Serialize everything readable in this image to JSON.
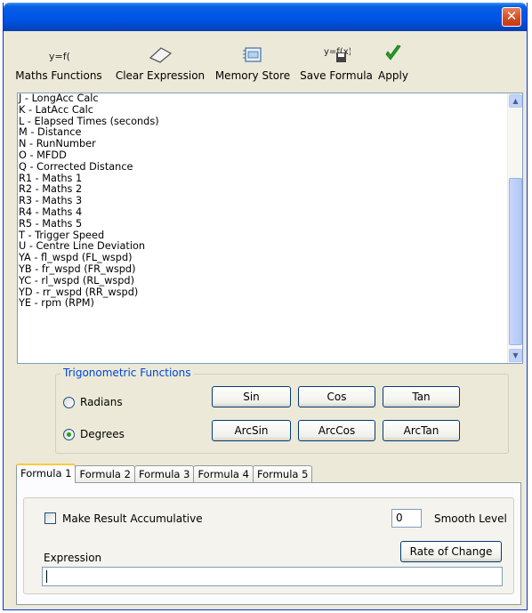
{
  "toolbar": {
    "buttons": [
      {
        "label": "Maths Functions",
        "icon": "function-icon"
      },
      {
        "label": "Clear Expression",
        "icon": "eraser-icon"
      },
      {
        "label": "Memory Store",
        "icon": "memory-card-icon"
      },
      {
        "label": "Save Formula",
        "icon": "save-formula-icon"
      },
      {
        "label": "Apply",
        "icon": "checkmark-icon"
      }
    ]
  },
  "channels": [
    "J - LongAcc Calc",
    "K - LatAcc Calc",
    "L - Elapsed Times (seconds)",
    "M - Distance",
    "N - RunNumber",
    "O - MFDD",
    "Q - Corrected Distance",
    "R1 - Maths 1",
    "R2 - Maths 2",
    "R3 - Maths 3",
    "R4 - Maths 4",
    "R5 - Maths 5",
    "T - Trigger Speed",
    "U - Centre Line Deviation",
    "YA - fl_wspd (FL_wspd)",
    "YB - fr_wspd (FR_wspd)",
    "YC - rl_wspd (RL_wspd)",
    "YD - rr_wspd (RR_wspd)",
    "YE - rpm (RPM)"
  ],
  "trig": {
    "title": "Trigonometric Functions",
    "radians_label": "Radians",
    "degrees_label": "Degrees",
    "selected": "Degrees",
    "buttons": [
      "Sin",
      "Cos",
      "Tan",
      "ArcSin",
      "ArcCos",
      "ArcTan"
    ]
  },
  "tabs": [
    "Formula 1",
    "Formula 2",
    "Formula 3",
    "Formula 4",
    "Formula 5"
  ],
  "active_tab": "Formula 1",
  "formula": {
    "accumulative_label": "Make Result Accumulative",
    "accumulative_checked": false,
    "smooth_value": "0",
    "smooth_label": "Smooth Level",
    "rate_button": "Rate of Change",
    "expression_label": "Expression",
    "expression_value": ""
  },
  "colors": {
    "titlebar": "#0054e3",
    "window_bg": "#ece9d8",
    "accent_blue": "#0046d5",
    "close_button": "#d34a24",
    "apply_check": "#21a121"
  }
}
